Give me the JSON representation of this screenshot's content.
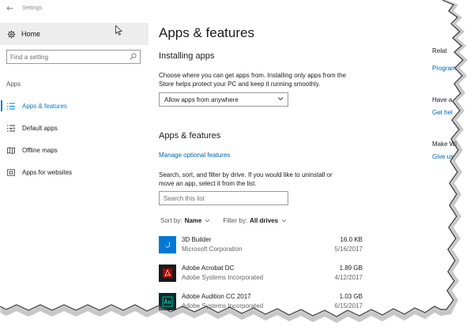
{
  "window": {
    "title": "Settings"
  },
  "sidebar": {
    "home_label": "Home",
    "search_placeholder": "Find a setting",
    "section_label": "Apps",
    "items": [
      {
        "label": "Apps & features",
        "icon": "list-icon",
        "active": true
      },
      {
        "label": "Default apps",
        "icon": "default-apps-icon",
        "active": false
      },
      {
        "label": "Offline maps",
        "icon": "map-icon",
        "active": false
      },
      {
        "label": "Apps for websites",
        "icon": "web-icon",
        "active": false
      }
    ]
  },
  "main": {
    "page_title": "Apps & features",
    "installing": {
      "heading": "Installing apps",
      "description_line1": "Choose where you can get apps from. Installing only apps from the",
      "description_line2": "Store helps protect your PC and keep it running smoothly.",
      "dropdown_value": "Allow apps from anywhere"
    },
    "apps_features": {
      "heading": "Apps & features",
      "manage_link": "Manage optional features",
      "description_line1": "Search, sort, and filter by drive. If you would like to uninstall or",
      "description_line2": "move an app, select it from the list.",
      "search_placeholder": "Search this list",
      "sort_label": "Sort by:",
      "sort_value": "Name",
      "filter_label": "Filter by:",
      "filter_value": "All drives"
    },
    "apps": [
      {
        "name": "3D Builder",
        "publisher": "Microsoft Corporation",
        "size": "16.0 KB",
        "date": "5/16/2017",
        "tile_color": "#0078d7"
      },
      {
        "name": "Adobe Acrobat DC",
        "publisher": "Adobe Systems Incorporated",
        "size": "1.89 GB",
        "date": "4/12/2017",
        "tile_color": "#1a1a1a"
      },
      {
        "name": "Adobe Audition CC 2017",
        "publisher": "Adobe Systems Incorporated",
        "size": "1.03 GB",
        "date": "6/15/2017",
        "tile_color": "#0b2b2e"
      }
    ]
  },
  "related": {
    "heading": "Relat",
    "programs_link": "Program",
    "have_a": "Have a",
    "get_help_link": "Get hel",
    "make_wi": "Make Wi",
    "give_us_link": "Give us"
  },
  "colors": {
    "accent": "#0078d7",
    "link": "#0063b1",
    "home_bg": "#ededed"
  }
}
